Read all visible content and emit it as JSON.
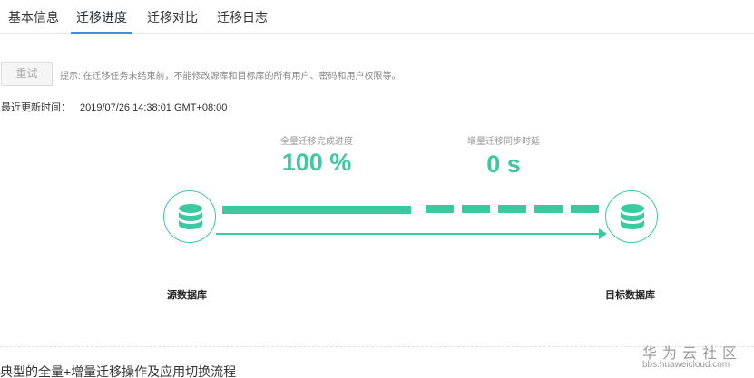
{
  "tabs": [
    {
      "label": "基本信息",
      "active": false
    },
    {
      "label": "迁移进度",
      "active": true
    },
    {
      "label": "迁移对比",
      "active": false
    },
    {
      "label": "迁移日志",
      "active": false
    }
  ],
  "toolbar": {
    "retry_label": "重试",
    "hint": "提示: 在迁移任务未结束前，不能修改源库和目标库的所有用户、密码和用户权限等。"
  },
  "last_update": {
    "label": "最近更新时间：",
    "value": "2019/07/26 14:38:01 GMT+08:00"
  },
  "metrics": {
    "full": {
      "label": "全量迁移完成进度",
      "value": "100 %"
    },
    "incremental": {
      "label": "增量迁移同步时延",
      "value": "0 s"
    }
  },
  "nodes": {
    "source": "源数据库",
    "target": "目标数据库"
  },
  "progress": {
    "full_fraction": 1.0
  },
  "section_title": "典型的全量+增量迁移操作及应用切换流程",
  "watermark": {
    "main": "华为云社区",
    "sub": "bbs.huaweicloud.com"
  },
  "colors": {
    "accent": "#3cc8a0",
    "tab_active": "#3c8fdb"
  },
  "icons": {
    "source": "database-icon",
    "target": "database-icon"
  }
}
